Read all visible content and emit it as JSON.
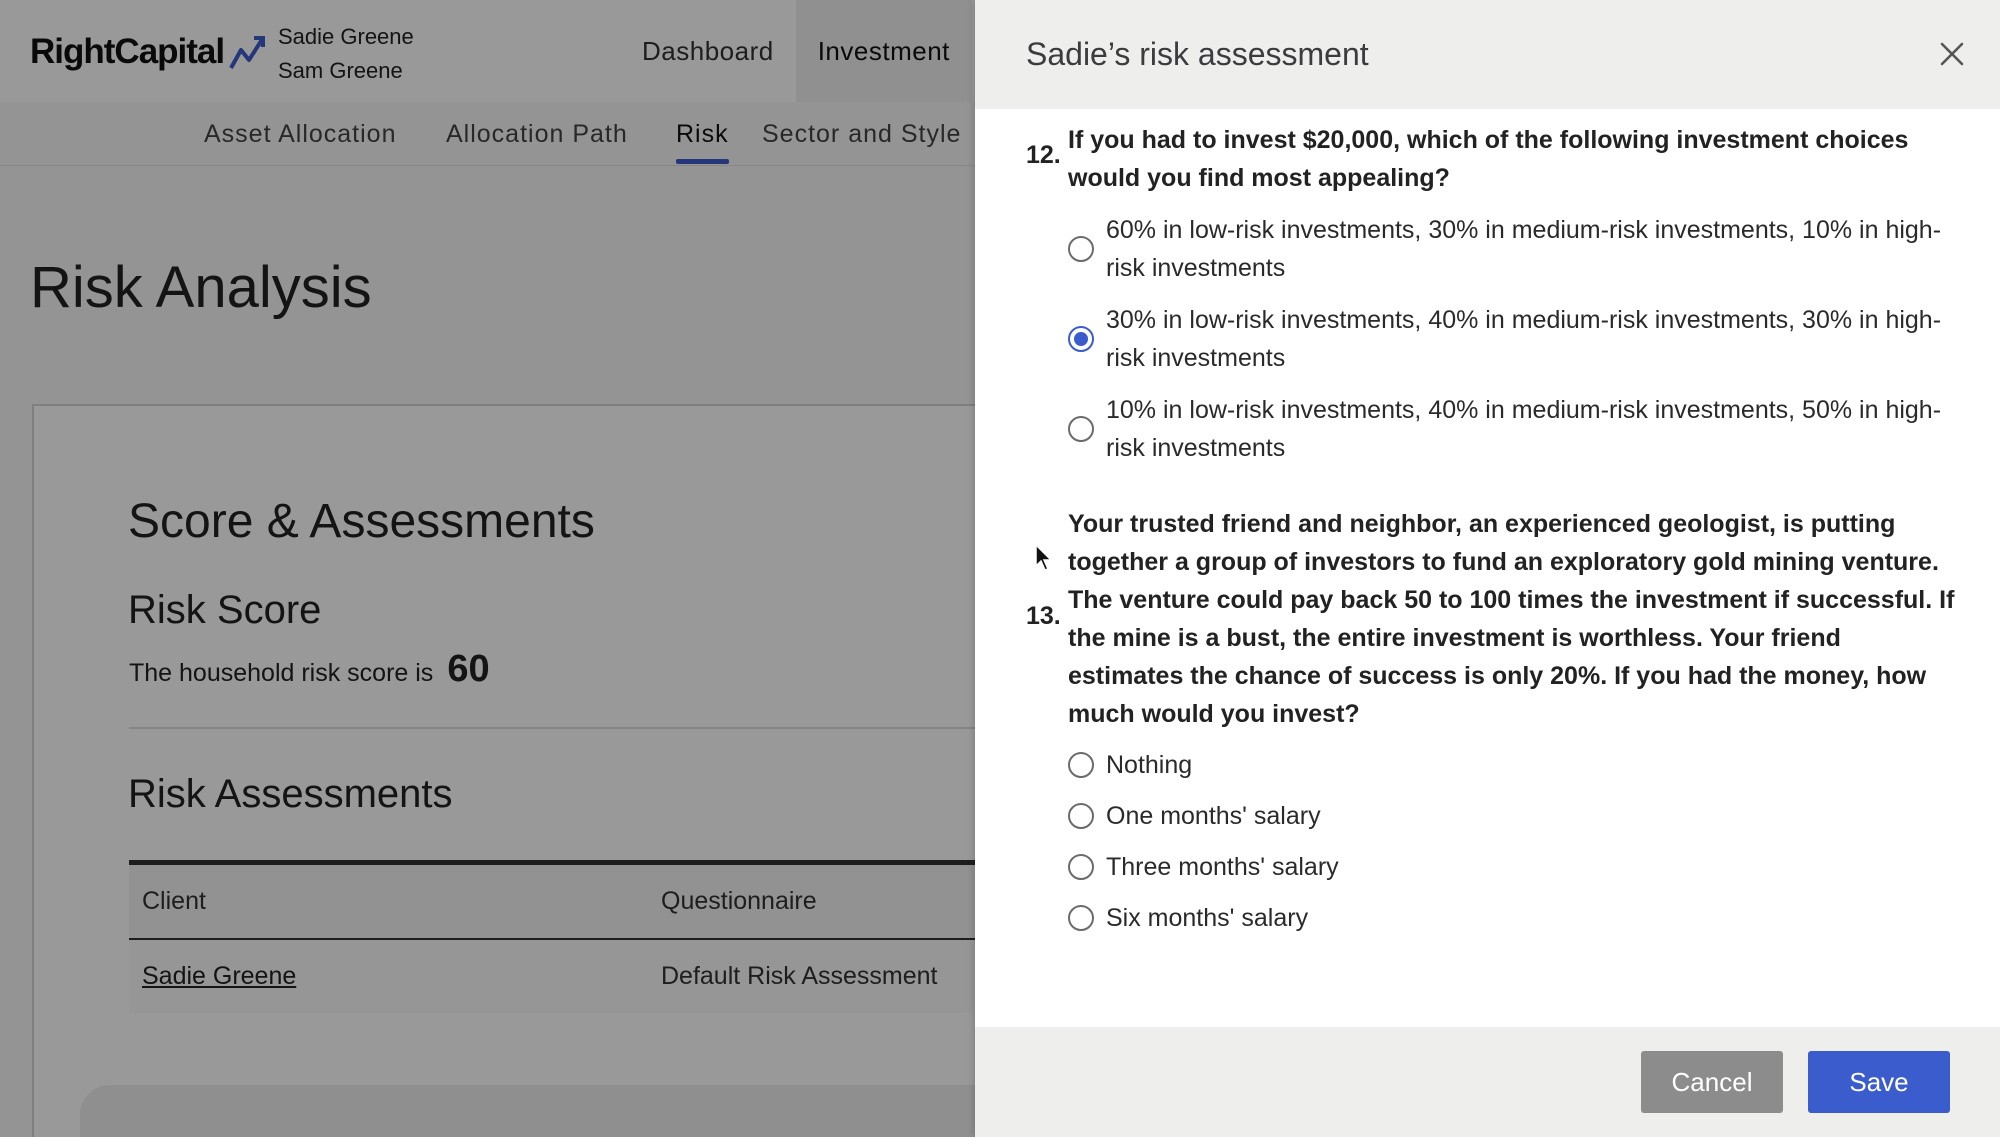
{
  "app": {
    "logo": "RightCapital",
    "household": [
      "Sadie Greene",
      "Sam Greene"
    ],
    "main_nav": [
      {
        "label": "Dashboard",
        "active": false
      },
      {
        "label": "Investment",
        "active": true
      }
    ],
    "sub_nav": [
      {
        "label": "Asset Allocation",
        "active": false
      },
      {
        "label": "Allocation Path",
        "active": false
      },
      {
        "label": "Risk",
        "active": true
      },
      {
        "label": "Sector and Style",
        "active": false
      }
    ],
    "page_title": "Risk Analysis",
    "section_title": "Score & Assessments",
    "risk_score": {
      "title": "Risk Score",
      "prefix": "The household risk score is",
      "value": "60"
    },
    "assessments": {
      "title": "Risk Assessments",
      "columns": [
        "Client",
        "Questionnaire"
      ],
      "rows": [
        {
          "client": "Sadie Greene",
          "questionnaire": "Default Risk Assessment"
        }
      ]
    }
  },
  "drawer": {
    "title": "Sadie’s risk assessment",
    "close_icon": "close-icon",
    "questions": [
      {
        "number": "12.",
        "text": "If you had to invest $20,000, which of the following investment choices would you find most appealing?",
        "options": [
          {
            "label": "60% in low-risk investments, 30% in medium-risk investments, 10% in high-risk investments",
            "selected": false
          },
          {
            "label": "30% in low-risk investments, 40% in medium-risk investments, 30% in high-risk investments",
            "selected": true
          },
          {
            "label": "10% in low-risk investments, 40% in medium-risk investments, 50% in high-risk investments",
            "selected": false
          }
        ]
      },
      {
        "number": "13.",
        "text": "Your trusted friend and neighbor, an experienced geologist, is putting together a group of investors to fund an exploratory gold mining venture. The venture could pay back 50 to 100 times the investment if successful. If the mine is a bust, the entire investment is worthless. Your friend estimates the chance of success is only 20%. If you had the money, how much would you invest?",
        "options": [
          {
            "label": "Nothing",
            "selected": false
          },
          {
            "label": "One months' salary",
            "selected": false
          },
          {
            "label": "Three months' salary",
            "selected": false
          },
          {
            "label": "Six months' salary",
            "selected": false
          }
        ]
      }
    ],
    "footer": {
      "cancel_label": "Cancel",
      "save_label": "Save"
    }
  },
  "colors": {
    "accent": "#3b5ccc",
    "cancel": "#8c8c8c",
    "header_bg": "#eeeeec"
  }
}
